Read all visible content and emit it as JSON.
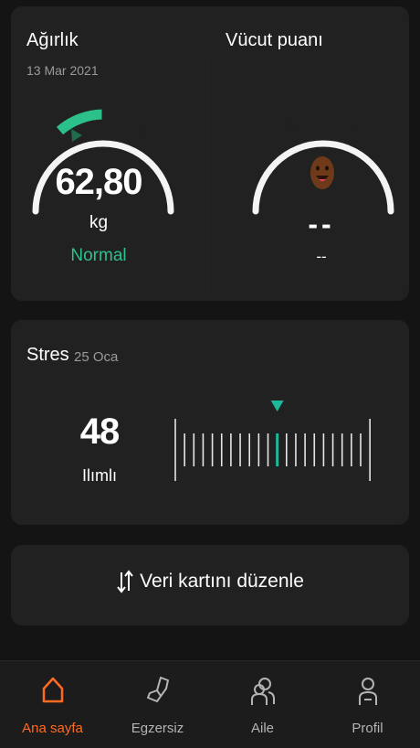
{
  "weight_card": {
    "title": "Ağırlık",
    "date": "13 Mar 2021",
    "value": "62,80",
    "unit": "kg",
    "status": "Normal",
    "status_color": "#2cc08a"
  },
  "body_score_card": {
    "title": "Vücut puanı",
    "value": "--",
    "sub_value": "--",
    "face_icon": "smiley-face-icon"
  },
  "stress_card": {
    "title": "Stres",
    "date": "25 Oca",
    "value": "48",
    "level": "Ilımlı",
    "level_fraction": 0.48,
    "accent_color": "#1fb79a"
  },
  "edit_card": {
    "label": "Veri kartını düzenle",
    "icon": "sort-arrows-icon"
  },
  "bottom_nav": {
    "items": [
      {
        "label": "Ana sayfa",
        "icon": "home-icon",
        "active": true
      },
      {
        "label": "Egzersiz",
        "icon": "shoe-icon",
        "active": false
      },
      {
        "label": "Aile",
        "icon": "family-icon",
        "active": false
      },
      {
        "label": "Profil",
        "icon": "profile-icon",
        "active": false
      }
    ],
    "active_color": "#ff6a21"
  }
}
